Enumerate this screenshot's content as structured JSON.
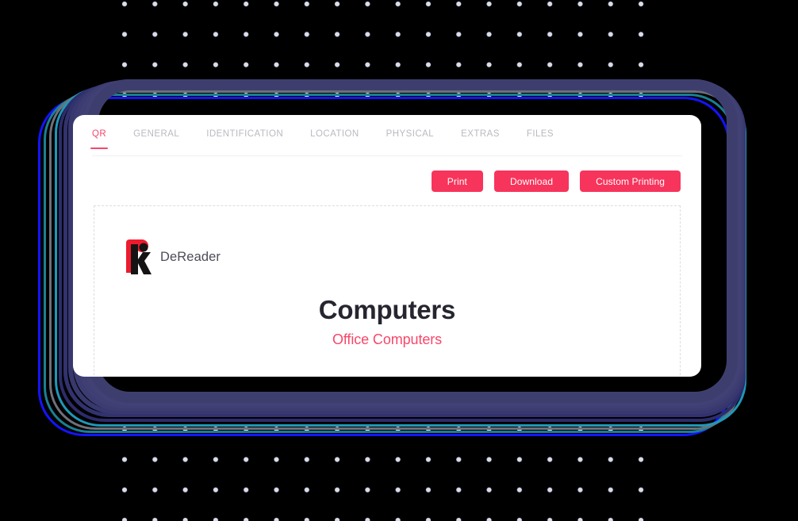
{
  "background": {
    "canvas_color": "#000000",
    "dot_color": "#d8dceb"
  },
  "glow": {
    "description": "layered offset rounded-rectangle outlines behind the card",
    "colors": [
      "#1414ff",
      "#1a8fa0",
      "#7b7b86",
      "#2d2d6e",
      "#3b3b73",
      "#00d7ff"
    ]
  },
  "tabs": {
    "items": [
      {
        "label": "QR",
        "active": true
      },
      {
        "label": "GENERAL",
        "active": false
      },
      {
        "label": "IDENTIFICATION",
        "active": false
      },
      {
        "label": "LOCATION",
        "active": false
      },
      {
        "label": "PHYSICAL",
        "active": false
      },
      {
        "label": "EXTRAS",
        "active": false
      },
      {
        "label": "FILES",
        "active": false
      }
    ],
    "active_color": "#f7476a",
    "inactive_color": "#b9b9c2"
  },
  "actions": {
    "buttons": [
      {
        "label": "Print"
      },
      {
        "label": "Download"
      },
      {
        "label": "Custom Printing"
      }
    ],
    "button_color": "#f7345b",
    "button_text_color": "#ffffff"
  },
  "preview": {
    "brand": {
      "logo_icon": "dereader-logo-icon",
      "name": "DeReader",
      "logo_red": "#ed1b2e",
      "logo_dark": "#1a1a1a",
      "name_color": "#4d4d58"
    },
    "title": "Computers",
    "subtitle": "Office Computers",
    "title_color": "#262630",
    "subtitle_color": "#f7476a",
    "border_style": "dashed",
    "border_color": "#dcdce2"
  }
}
